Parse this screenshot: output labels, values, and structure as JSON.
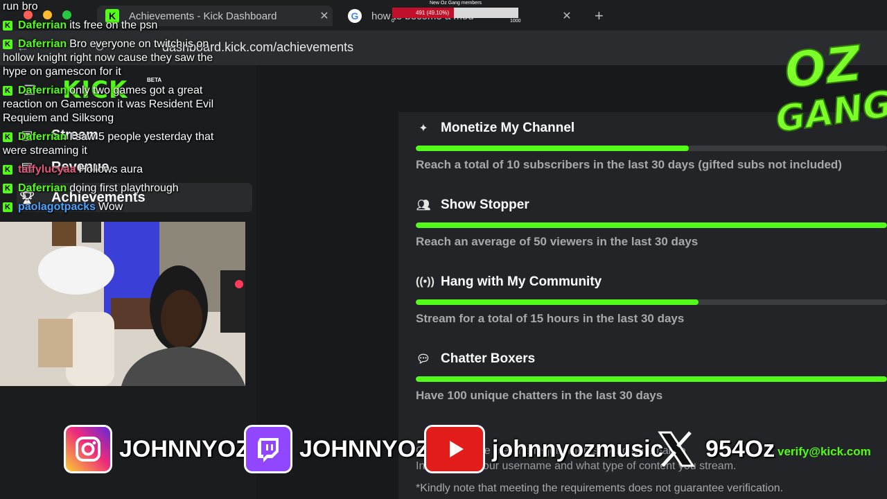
{
  "browser": {
    "tabs": [
      {
        "title": "Achievements - Kick Dashboard",
        "icon": "kick-icon"
      },
      {
        "title": "how to become a mod",
        "icon": "google-icon"
      }
    ],
    "url_prefix": "https://",
    "url": "dashboard.kick.com/achievements"
  },
  "sidebar": {
    "logo": "KICK",
    "beta": "BETA",
    "items": [
      {
        "label": "Stream",
        "icon": "stream-icon"
      },
      {
        "label": "Revenue",
        "icon": "revenue-icon"
      },
      {
        "label": "Achievements",
        "icon": "trophy-icon"
      }
    ]
  },
  "achievements": [
    {
      "title": "Monetize My Channel",
      "icon": "sparkle-icon",
      "progress": 0.58,
      "desc": "Reach a total of 10 subscribers in the last 30 days (gifted subs not included)"
    },
    {
      "title": "Show Stopper",
      "icon": "viewers-icon",
      "progress": 1.0,
      "desc": "Reach an average of 50 viewers in the last 30 days"
    },
    {
      "title": "Hang with My Community",
      "icon": "broadcast-icon",
      "progress": 0.6,
      "desc": "Stream for a total of 15 hours in the last 30 days"
    },
    {
      "title": "Chatter Boxers",
      "icon": "chat-icon",
      "progress": 1.0,
      "desc": "Have 100 unique chatters in the last 30 days"
    }
  ],
  "footer": {
    "line1": "Once you have met the requirements, send an email to",
    "email": "verify@kick.com",
    "line2": "Information: your username and what type of content you stream.",
    "line3": "*Kindly note that meeting the requirements does not guarantee verification."
  },
  "chat": [
    {
      "user": "",
      "text": "run bro",
      "badge": false
    },
    {
      "user": "Daferrian",
      "text": "its free on the psn",
      "badge": true,
      "color": "#53fc18"
    },
    {
      "user": "Daferrian",
      "text": "Bro everyone on twitch is on hollow knight right now cause they saw the hype on gamescon for it",
      "badge": true,
      "color": "#53fc18"
    },
    {
      "user": "Daferrian",
      "text": "only two games got a great reaction on Gamescon it was Resident Evil Requiem and Silksong",
      "badge": true,
      "color": "#53fc18"
    },
    {
      "user": "Daferrian",
      "text": "I saw 5 people yesterday that were streaming it",
      "badge": true,
      "color": "#53fc18"
    },
    {
      "user": "taffylucyaa",
      "text": "Hollows aura",
      "badge": true,
      "color": "#e0577a"
    },
    {
      "user": "Daferrian",
      "text": "doing first playthrough",
      "badge": true,
      "color": "#53fc18"
    },
    {
      "user": "paolagotpacks",
      "text": "Wow",
      "badge": true,
      "color": "#4aa3ff"
    }
  ],
  "goal": {
    "title": "New Oz Gang members",
    "value_label": "491 (49.10%)",
    "min": "0",
    "max": "1000",
    "fraction": 0.491
  },
  "brand": {
    "line1": "OZ",
    "line2": "GANG"
  },
  "socials": [
    {
      "handle": "JOHNNYOZ",
      "icon": "instagram-icon"
    },
    {
      "handle": "JOHNNYOZ",
      "icon": "twitch-icon"
    },
    {
      "handle": "johnnyozmusic",
      "icon": "youtube-icon"
    },
    {
      "handle": "954Oz",
      "icon": "x-icon"
    }
  ],
  "colors": {
    "accent": "#53fc18",
    "youtube": "#e21b1b",
    "twitch": "#9146ff",
    "goal_fill": "#c0102a"
  }
}
